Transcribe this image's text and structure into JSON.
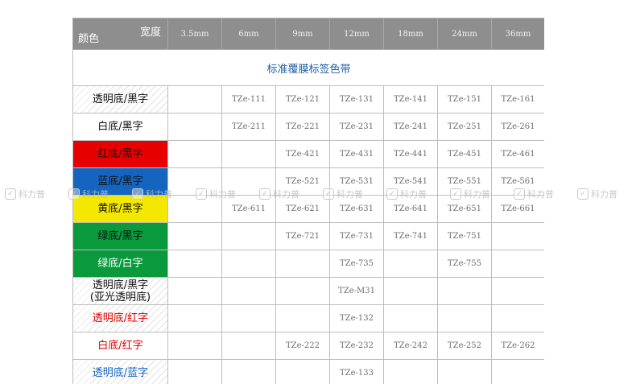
{
  "header": {
    "width_label": "宽度",
    "color_label": "颜色",
    "widths": [
      "3.5mm",
      "6mm",
      "9mm",
      "12mm",
      "18mm",
      "24mm",
      "36mm"
    ]
  },
  "title": "标准覆膜标签色带",
  "rows": [
    {
      "label": "透明底/黑字",
      "bg": "clear",
      "text_color": "#111111",
      "cells": [
        "",
        "TZe-111",
        "TZe-121",
        "TZe-131",
        "TZe-141",
        "TZe-151",
        "TZe-161"
      ]
    },
    {
      "label": "白底/黑字",
      "bg": "white",
      "text_color": "#111111",
      "cells": [
        "",
        "TZe-211",
        "TZe-221",
        "TZe-231",
        "TZe-241",
        "TZe-251",
        "TZe-261"
      ]
    },
    {
      "label": "红底/黑字",
      "bg": "red",
      "text_color": "#111111",
      "cells": [
        "",
        "",
        "TZe-421",
        "TZe-431",
        "TZe-441",
        "TZe-451",
        "TZe-461"
      ]
    },
    {
      "label": "蓝底/黑字",
      "bg": "blue",
      "text_color": "#111111",
      "cells": [
        "",
        "",
        "TZe-521",
        "TZe-531",
        "TZe-541",
        "TZe-551",
        "TZe-561"
      ]
    },
    {
      "label": "黄底/黑字",
      "bg": "yellow",
      "text_color": "#111111",
      "cells": [
        "",
        "TZe-611",
        "TZe-621",
        "TZe-631",
        "TZe-641",
        "TZe-651",
        "TZe-661"
      ]
    },
    {
      "label": "绿底/黑字",
      "bg": "green",
      "text_color": "#111111",
      "cells": [
        "",
        "",
        "TZe-721",
        "TZe-731",
        "TZe-741",
        "TZe-751",
        ""
      ]
    },
    {
      "label": "绿底/白字",
      "bg": "green",
      "text_color": "#ffffff",
      "cells": [
        "",
        "",
        "",
        "TZe-735",
        "",
        "TZe-755",
        ""
      ]
    },
    {
      "label": "透明底/黑字",
      "label2": "(亚光透明底)",
      "bg": "clear",
      "text_color": "#111111",
      "cells": [
        "",
        "",
        "",
        "TZe-M31",
        "",
        "",
        ""
      ]
    },
    {
      "label": "透明底/红字",
      "bg": "clear",
      "text_color": "#e00000",
      "cells": [
        "",
        "",
        "",
        "TZe-132",
        "",
        "",
        ""
      ]
    },
    {
      "label": "白底/红字",
      "bg": "white",
      "text_color": "#e00000",
      "cells": [
        "",
        "",
        "TZe-222",
        "TZe-232",
        "TZe-242",
        "TZe-252",
        "TZe-262"
      ]
    },
    {
      "label": "透明底/蓝字",
      "bg": "clear",
      "text_color": "#1565c0",
      "cells": [
        "",
        "",
        "",
        "TZe-133",
        "",
        "",
        ""
      ]
    }
  ],
  "watermark": {
    "text": "科力普",
    "icon": "check-bubble-icon",
    "count": 10
  },
  "colors": {
    "header_bg": "#8e8e8e",
    "title_text": "#1f5fa5",
    "red": "#e60000",
    "blue": "#1565c0",
    "yellow": "#f5e800",
    "green": "#0a9a3c"
  }
}
